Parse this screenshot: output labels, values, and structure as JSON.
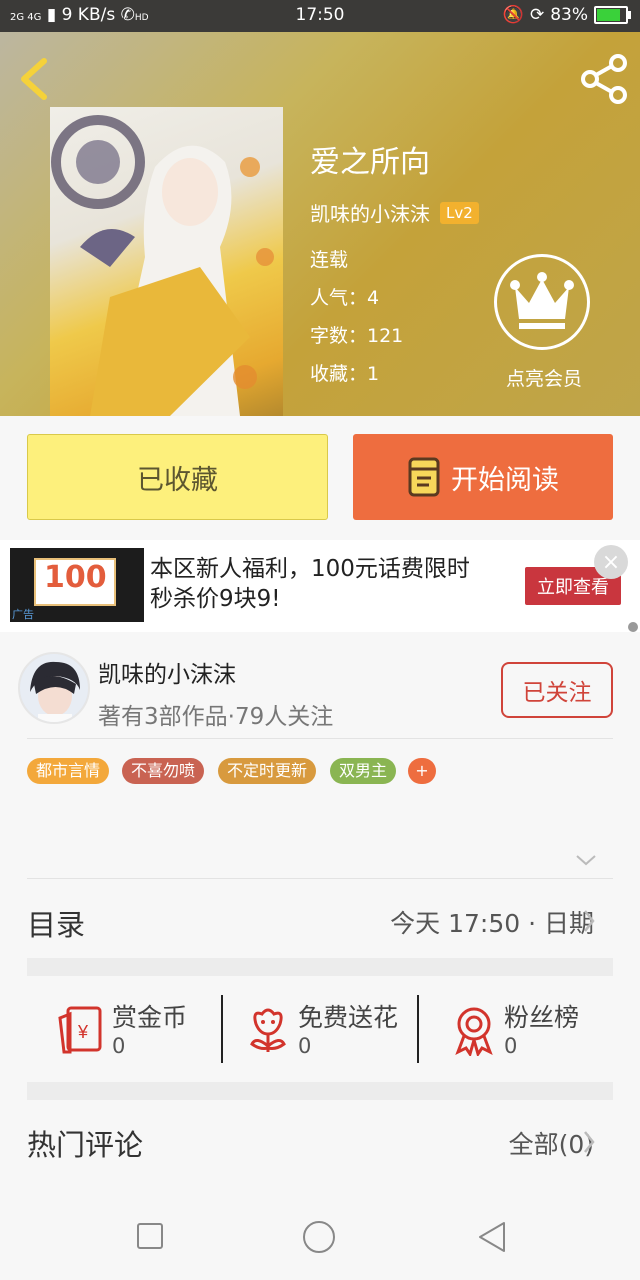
{
  "status_bar": {
    "network": "2G 4G",
    "speed": "9 KB/s",
    "call_icon": "HD",
    "time": "17:50",
    "battery": "83%",
    "battery_level": 0.83
  },
  "book": {
    "title": "爱之所向",
    "author": "凯味的小沫沫",
    "level": "Lv2",
    "status": "连载",
    "popularity": "人气：4",
    "word_count": "字数：121",
    "favorites": "收藏：1",
    "vip_label": "点亮会员"
  },
  "actions": {
    "collect_label": "已收藏",
    "read_label": "开始阅读"
  },
  "ad": {
    "image_price": "100",
    "image_small": "广告",
    "text": "本区新人福利，100元话费限时秒杀价9块9!",
    "cta": "立即查看",
    "close": "×"
  },
  "author_card": {
    "name": "凯味的小沫沫",
    "stats": "著有3部作品·79人关注",
    "follow_label": "已关注"
  },
  "tags": [
    {
      "label": "都市言情",
      "color": "#f3a83b"
    },
    {
      "label": "不喜勿喷",
      "color": "#c96352"
    },
    {
      "label": "不定时更新",
      "color": "#d89a3e"
    },
    {
      "label": "双男主",
      "color": "#8ab552"
    },
    {
      "label": "+",
      "color": "#ee6d3f"
    }
  ],
  "toc": {
    "label": "目录",
    "right": "今天 17:50 · 日期"
  },
  "stats": [
    {
      "label": "赏金币",
      "value": "0",
      "icon": "red-envelope-icon"
    },
    {
      "label": "免费送花",
      "value": "0",
      "icon": "flower-icon"
    },
    {
      "label": "粉丝榜",
      "value": "0",
      "icon": "medal-icon"
    }
  ],
  "comments": {
    "label": "热门评论",
    "right": "全部(0)"
  },
  "colors": {
    "accent": "#ee6d3f",
    "collect_bg": "#fdf07c",
    "follow_red": "#d0443a"
  }
}
